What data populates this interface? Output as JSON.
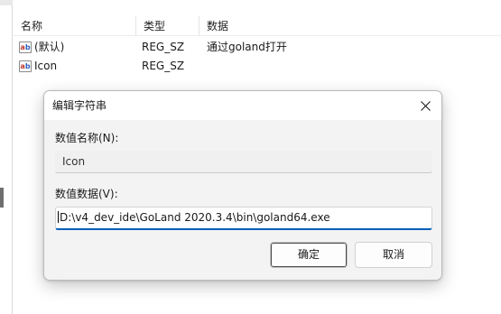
{
  "list": {
    "columns": {
      "name": "名称",
      "type": "类型",
      "data": "数据"
    },
    "rows": [
      {
        "icon": "reg-string-icon",
        "name": "(默认)",
        "type": "REG_SZ",
        "data": "通过goland打开"
      },
      {
        "icon": "reg-string-icon",
        "name": "Icon",
        "type": "REG_SZ",
        "data": ""
      }
    ]
  },
  "dialog": {
    "title": "编辑字符串",
    "close_icon": "close-icon",
    "value_name_label": "数值名称(N):",
    "value_name": "Icon",
    "value_data_label": "数值数据(V):",
    "value_data": "D:\\v4_dev_ide\\GoLand 2020.3.4\\bin\\goland64.exe",
    "ok_label": "确定",
    "cancel_label": "取消"
  }
}
